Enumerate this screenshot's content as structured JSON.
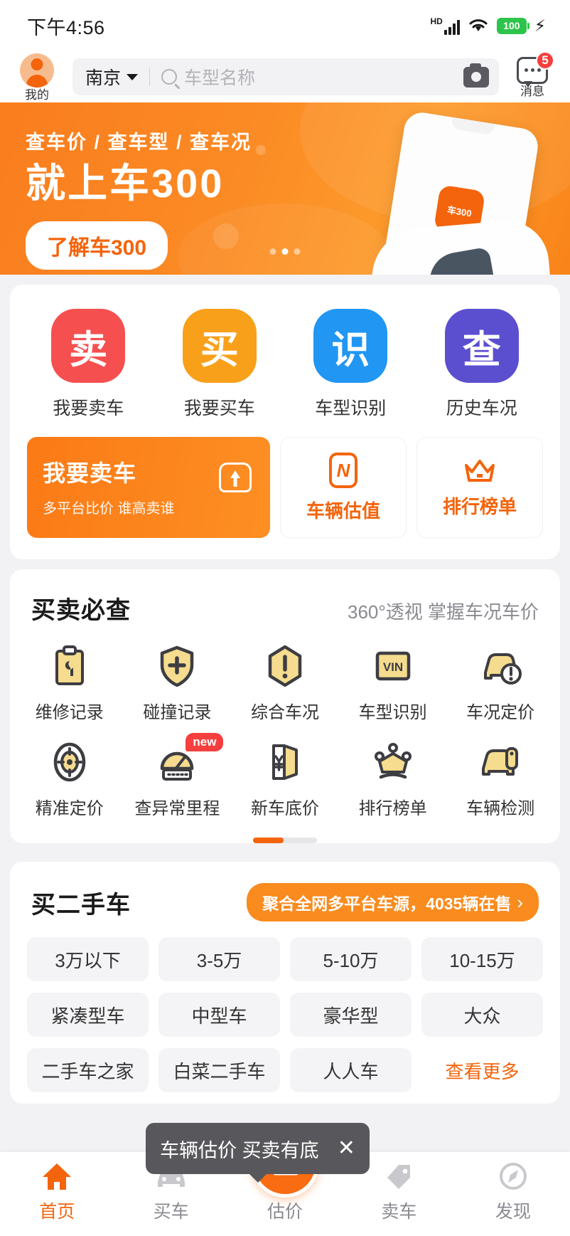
{
  "status_bar": {
    "time": "下午4:56",
    "network_label": "HD",
    "battery_level": "100",
    "charging_icon": "⚡"
  },
  "header": {
    "profile_label": "我的",
    "city": "南京",
    "search_placeholder": "车型名称",
    "camera_icon": "camera-icon",
    "message_label": "消息",
    "message_badge": "5"
  },
  "hero": {
    "subtitle": "查车价 / 查车型 / 查车况",
    "title": "就上车300",
    "cta": "了解车300",
    "app_icon_text": "车300",
    "dots": [
      "inactive",
      "active",
      "inactive"
    ]
  },
  "quick_tiles": [
    {
      "glyph": "卖",
      "label": "我要卖车",
      "color": "#f5504f"
    },
    {
      "glyph": "买",
      "label": "我要买车",
      "color": "#f9a01b"
    },
    {
      "glyph": "识",
      "label": "车型识别",
      "color": "#2196f3"
    },
    {
      "glyph": "查",
      "label": "历史车况",
      "color": "#5b4fcf"
    }
  ],
  "promos": {
    "main": {
      "title": "我要卖车",
      "subtitle": "多平台比价 谁高卖谁"
    },
    "small": [
      {
        "label": "车辆估值",
        "icon": "valuation-icon"
      },
      {
        "label": "排行榜单",
        "icon": "crown-icon"
      }
    ]
  },
  "must_check": {
    "title": "买卖必查",
    "subtitle": "360°透视 掌握车况车价",
    "items": [
      {
        "label": "维修记录",
        "icon": "clipboard-wrench-icon",
        "badge": ""
      },
      {
        "label": "碰撞记录",
        "icon": "shield-plus-icon",
        "badge": ""
      },
      {
        "label": "综合车况",
        "icon": "hexagon-alert-icon",
        "badge": ""
      },
      {
        "label": "车型识别",
        "icon": "vin-icon",
        "badge": ""
      },
      {
        "label": "车况定价",
        "icon": "car-alert-icon",
        "badge": ""
      },
      {
        "label": "精准定价",
        "icon": "target-icon",
        "badge": ""
      },
      {
        "label": "查异常里程",
        "icon": "odometer-icon",
        "badge": "new"
      },
      {
        "label": "新车底价",
        "icon": "price-tag-yuan-icon",
        "badge": ""
      },
      {
        "label": "排行榜单",
        "icon": "crown-icon",
        "badge": ""
      },
      {
        "label": "车辆检测",
        "icon": "car-inspect-icon",
        "badge": ""
      }
    ]
  },
  "used_car": {
    "title": "买二手车",
    "cta": "聚合全网多平台车源，4035辆在售",
    "cta_chevron": "›",
    "price_pills": [
      "3万以下",
      "3-5万",
      "5-10万",
      "10-15万"
    ],
    "type_pills": [
      "紧凑型车",
      "中型车",
      "豪华型",
      "大众"
    ],
    "source_pills": [
      "二手车之家",
      "白菜二手车",
      "人人车",
      "查看更多"
    ]
  },
  "tooltip": {
    "text": "车辆估价 买卖有底",
    "close_icon": "✕"
  },
  "bottom_nav": [
    {
      "label": "首页",
      "icon": "home-icon",
      "active": true
    },
    {
      "label": "买车",
      "icon": "car-icon",
      "active": false
    },
    {
      "label": "估价",
      "icon": "chart-icon",
      "active": false
    },
    {
      "label": "卖车",
      "icon": "tag-icon",
      "active": false
    },
    {
      "label": "发现",
      "icon": "compass-icon",
      "active": false
    }
  ],
  "colors": {
    "brand_orange": "#f4640c",
    "accent_orange": "#f98b1f",
    "badge_red": "#f53f3f",
    "icon_yellow": "#f5dc8e",
    "icon_dark": "#3d3d42"
  }
}
